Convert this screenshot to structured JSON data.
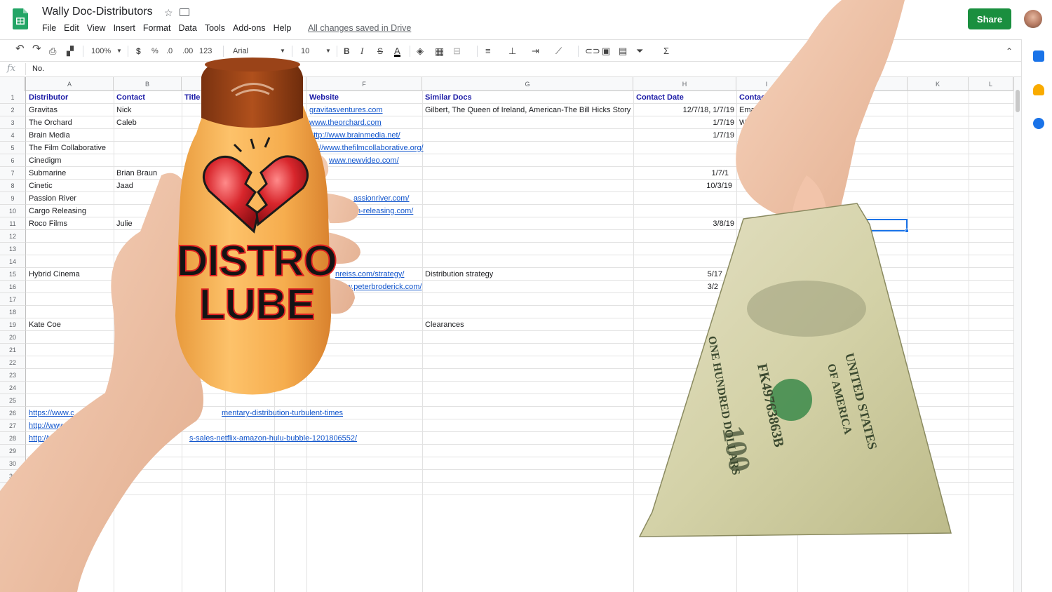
{
  "app": {
    "title": "Wally Doc-Distributors",
    "menu": [
      "File",
      "Edit",
      "View",
      "Insert",
      "Format",
      "Data",
      "Tools",
      "Add-ons",
      "Help"
    ],
    "save_status": "All changes saved in Drive",
    "share_label": "Share"
  },
  "toolbar": {
    "zoom": "100%",
    "currency": "$",
    "percent": "%",
    "decrease_decimals": ".0",
    "increase_decimals": ".00",
    "more_formats": "123",
    "font": "Arial",
    "font_size": "10",
    "bold": "B",
    "italic": "I",
    "strike": "S",
    "text_color": "A"
  },
  "formula_bar": {
    "fx": "fx",
    "value": "No."
  },
  "columns": [
    "A",
    "B",
    "",
    "",
    "",
    "F",
    "G",
    "H",
    "I",
    "",
    "K",
    "L"
  ],
  "rows": [
    "1",
    "2",
    "3",
    "4",
    "5",
    "6",
    "7",
    "8",
    "9",
    "10",
    "11",
    "12",
    "13",
    "14",
    "15",
    "16",
    "17",
    "18",
    "19",
    "20",
    "21",
    "22",
    "23",
    "24",
    "25",
    "26",
    "27",
    "28",
    "29",
    "30",
    "31",
    "32"
  ],
  "headers": {
    "distributor": "Distributor",
    "contact": "Contact",
    "title": "Title",
    "website": "Website",
    "similar_docs": "Similar Docs",
    "contact_date": "Contact Date",
    "contact_type": "Contact T"
  },
  "cells": {
    "a2": "Gravitas",
    "b2": "Nick",
    "f2": "gravitasventures.com",
    "g2": "Gilbert, The Queen of Ireland, American-The Bill Hicks Story",
    "h2": "12/7/18, 1/7/19",
    "i2": "Email",
    "a3": "The Orchard",
    "b3": "Caleb",
    "f3": "www.theorchard.com",
    "h3": "1/7/19",
    "i3": "We",
    "a4": "Brain Media",
    "f4": "http://www.brainmedia.net/",
    "h4": "1/7/19",
    "a5": "The Film Collaborative",
    "f5": "://www.thefilmcollaborative.org/",
    "a6": "Cinedigm",
    "f6": "www.newvideo.com/",
    "a7": "Submarine",
    "b7": "Brian Braun",
    "h7": "1/7/1",
    "a8": "Cinetic",
    "b8": "Jaad",
    "h8": "10/3/19",
    "a9": "Passion River",
    "f9": "assionriver.com/",
    "a10": "Cargo Releasing",
    "f10": "n-releasing.com/",
    "a11": "Roco Films",
    "b11": "Julie",
    "h11": "3/8/19",
    "a15": "Hybrid Cinema",
    "b15": "Jo",
    "f15": "nreiss.com/strategy/",
    "g15": "Distribution strategy",
    "h15": "5/17",
    "f16": "www.peterbroderick.com/",
    "h16": "3/2",
    "a19": "Kate Coe",
    "g19": "Clearances",
    "a26": "https://www.c",
    "e26": "mentary-distribution-turbulent-times",
    "a27": "http://www",
    "a28": "http://w",
    "e28": "s-sales-netflix-amazon-hulu-bubble-1201806552/"
  },
  "overlay": {
    "bottle_line1": "DISTRO",
    "bottle_line2": "LUBE",
    "bill_serial": "FK49763863B",
    "bill_line1": "UNITED STATES",
    "bill_line2": "OF AMERICA",
    "bill_value_words": "ONE HUNDRED DOLLARS",
    "bill_corner": "100"
  },
  "colors": {
    "accent_green": "#1a8f3f",
    "header_blue": "#1a1aa6",
    "link_blue": "#1155cc",
    "selection_blue": "#1a73e8"
  }
}
